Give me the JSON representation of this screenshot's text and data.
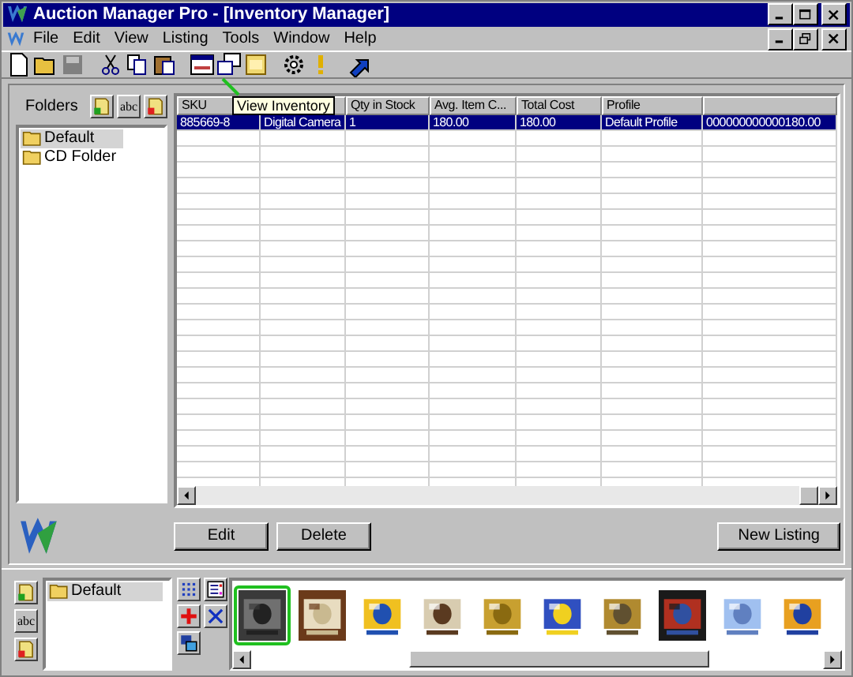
{
  "window": {
    "title": "Auction Manager Pro - [Inventory Manager]"
  },
  "menu": [
    "File",
    "Edit",
    "View",
    "Listing",
    "Tools",
    "Window",
    "Help"
  ],
  "tooltip": "View Inventory",
  "folders": {
    "label": "Folders",
    "abc": "abc",
    "items": [
      {
        "name": "Default",
        "selected": true
      },
      {
        "name": "CD Folder",
        "selected": false
      }
    ]
  },
  "grid": {
    "columns": [
      {
        "label": "SKU"
      },
      {},
      {
        "label": "Qty in Stock"
      },
      {
        "label": "Avg. Item C..."
      },
      {
        "label": "Total Cost"
      },
      {
        "label": "Profile"
      },
      {}
    ],
    "rows": [
      {
        "cells": [
          "885669-8",
          "Digital Camera",
          "1",
          "180.00",
          "180.00",
          "Default Profile",
          "000000000000180.00"
        ],
        "selected": true
      }
    ]
  },
  "buttons": [
    {
      "label": "Edit"
    },
    {
      "label": "Delete"
    },
    {
      "label": "New Listing"
    }
  ],
  "bottom": {
    "abc": "abc",
    "folders": [
      {
        "name": "Default",
        "selected": true
      }
    ],
    "thumbnails": [
      {
        "kind": "picture",
        "selected": true
      },
      {
        "kind": "picture",
        "selected": false
      },
      {
        "kind": "picture",
        "selected": false
      },
      {
        "kind": "picture",
        "selected": false
      },
      {
        "kind": "picture",
        "selected": false
      },
      {
        "kind": "picture",
        "selected": false
      },
      {
        "kind": "picture",
        "selected": false
      },
      {
        "kind": "picture",
        "selected": false
      },
      {
        "kind": "picture",
        "selected": false
      },
      {
        "kind": "picture",
        "selected": false
      }
    ]
  }
}
